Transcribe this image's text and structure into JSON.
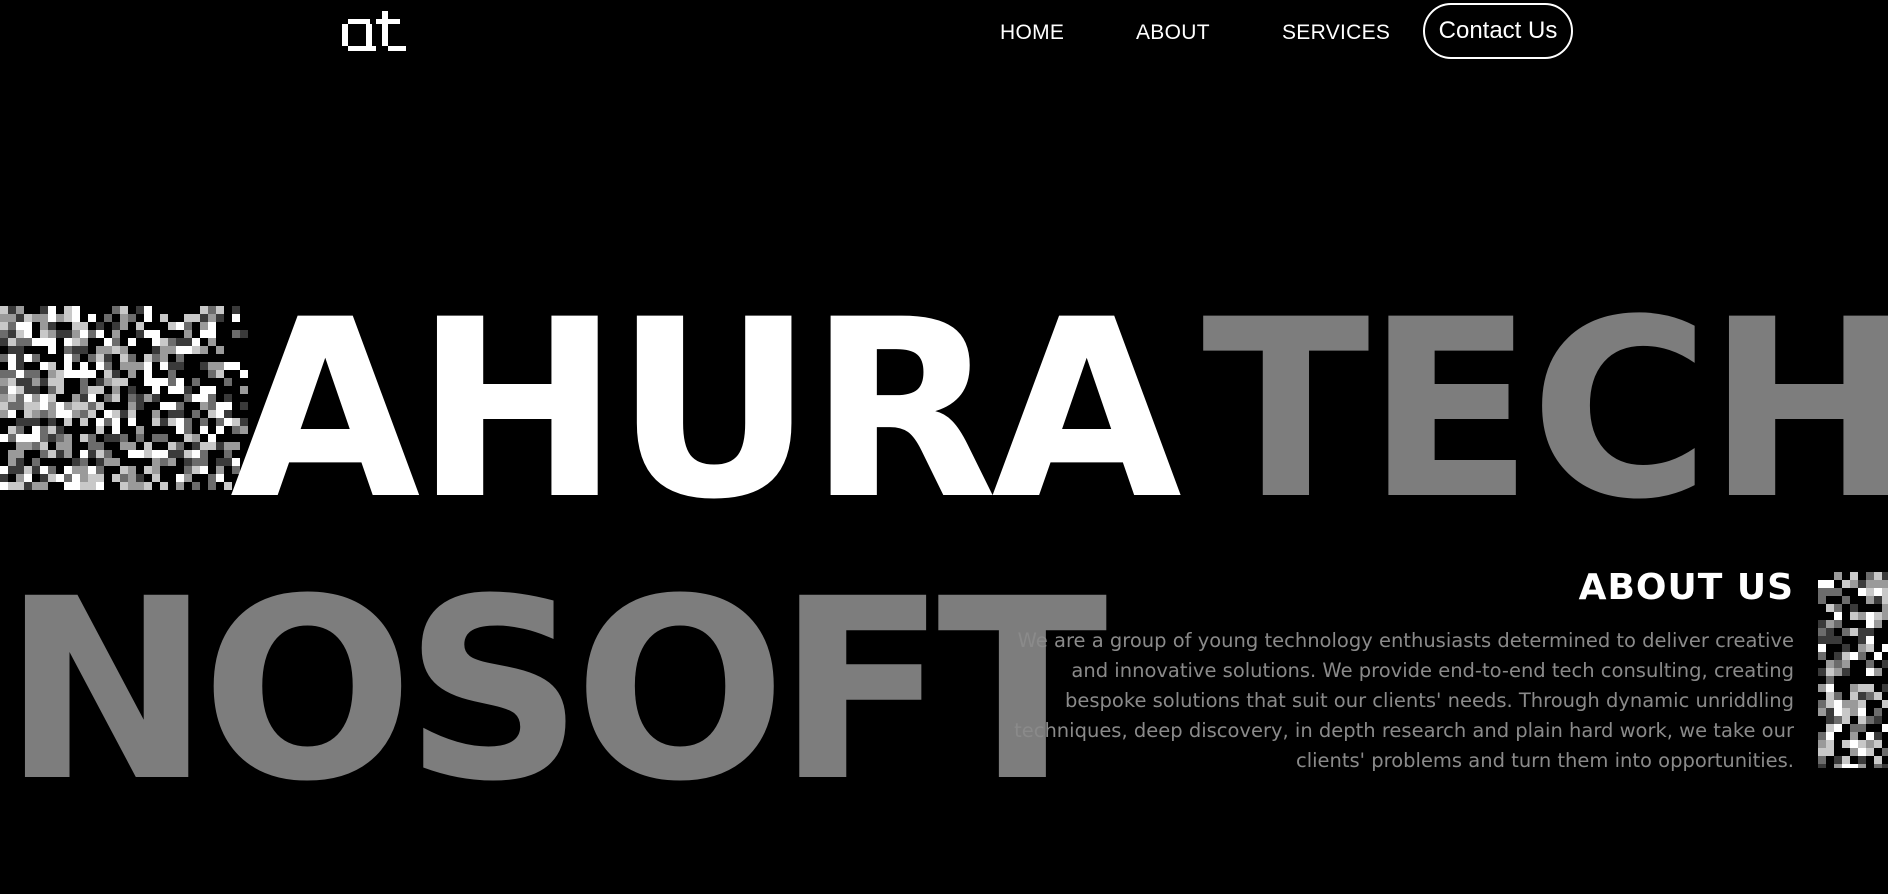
{
  "header": {
    "logo_text": "at",
    "nav": {
      "home": "HOME",
      "about": "ABOUT",
      "services": "SERVICES"
    },
    "contact_label": "Contact Us"
  },
  "hero": {
    "line1_white": "AHURA",
    "line1_grey": "TECH",
    "line2": "NOSOFT"
  },
  "about": {
    "heading": "ABOUT US",
    "body": "We are a group of young technology enthusiasts determined to deliver creative and innovative solutions. We provide end-to-end tech consulting, creating bespoke solutions that suit our clients' needs. Through dynamic unriddling techniques, deep discovery, in depth research and plain hard work, we take our clients' problems and turn them into opportunities."
  },
  "colors": {
    "background": "#000000",
    "primary_text": "#ffffff",
    "muted_text": "#7d7d7d"
  }
}
